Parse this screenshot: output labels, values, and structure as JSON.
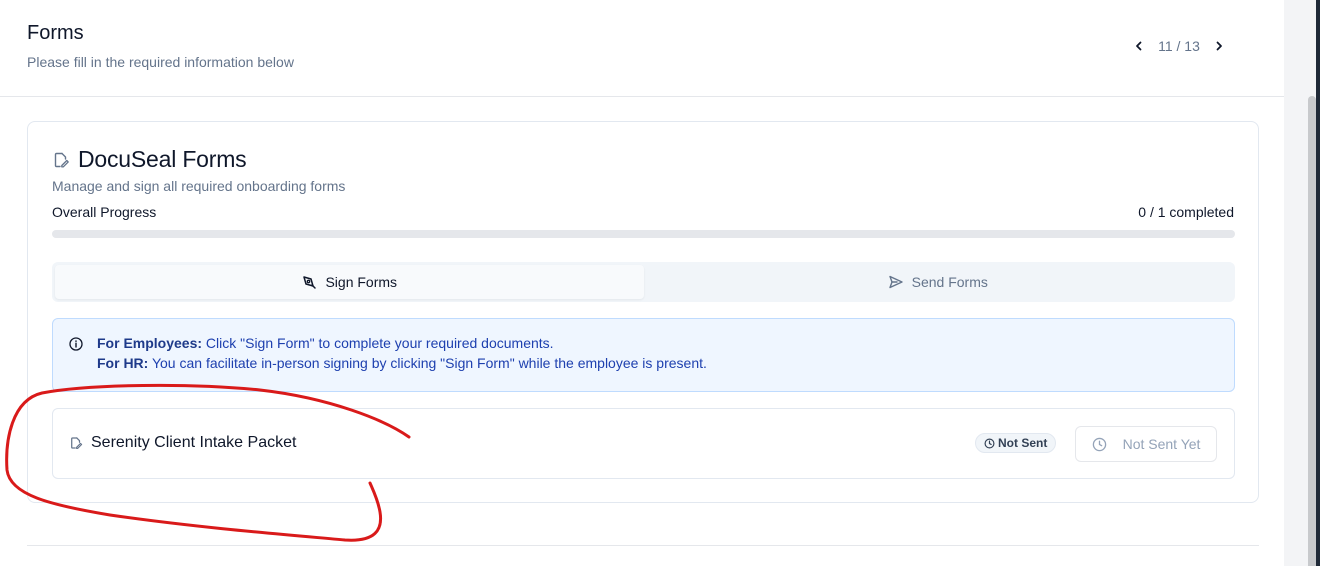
{
  "header": {
    "title": "Forms",
    "subtitle": "Please fill in the required information below",
    "pager": {
      "text": "11 / 13",
      "prev_icon": "chevron-left-icon",
      "next_icon": "chevron-right-icon"
    }
  },
  "card": {
    "title": "DocuSeal Forms",
    "title_icon": "file-edit-icon",
    "description": "Manage and sign all required onboarding forms",
    "progress": {
      "label": "Overall Progress",
      "count_text": "0 / 1 completed",
      "fraction": 0
    },
    "tabs": [
      {
        "label": "Sign Forms",
        "icon": "signature-icon",
        "active": true
      },
      {
        "label": "Send Forms",
        "icon": "send-icon",
        "active": false
      }
    ],
    "info": {
      "icon": "info-icon",
      "line1_label": "For Employees:",
      "line1_text": " Click \"Sign Form\" to complete your required documents.",
      "line2_label": "For HR:",
      "line2_text": " You can facilitate in-person signing by clicking \"Sign Form\" while the employee is present."
    },
    "forms": [
      {
        "name": "Serenity Client Intake Packet",
        "icon": "file-edit-icon",
        "status_badge": "Not Sent",
        "status_icon": "clock-icon",
        "action_label": "Not Sent Yet",
        "action_icon": "clock-icon"
      }
    ]
  },
  "colors": {
    "info_bg": "#eff6ff",
    "info_text": "#1e40af",
    "annotation": "#d91a1a",
    "muted": "#64748b"
  }
}
